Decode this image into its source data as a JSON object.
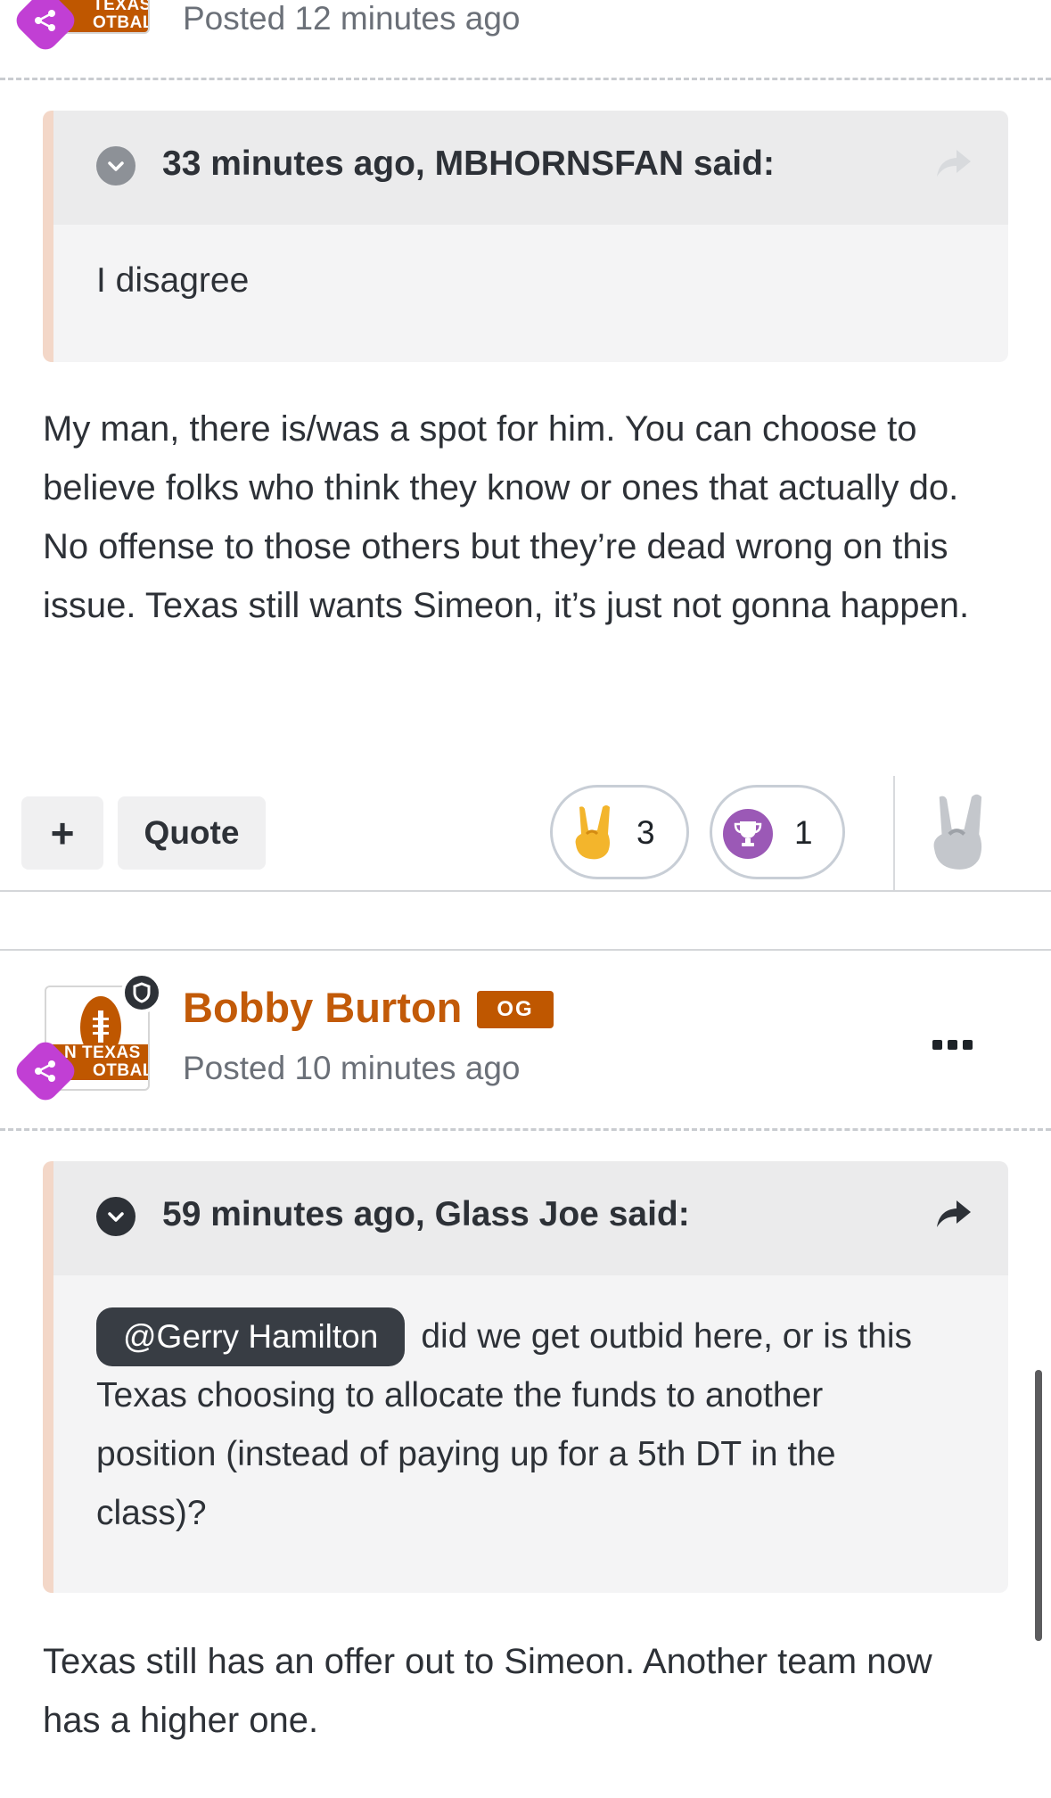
{
  "post1": {
    "posted_time": "Posted 12 minutes ago",
    "avatar_text": "TEXAS\nOTBALL",
    "quote": {
      "header": "33 minutes ago, MBHORNSFAN said:",
      "body": "I disagree"
    },
    "body": "My man, there is/was a spot for him. You can choose to believe folks who think they know or ones that actually do. No offense to those others but they’re dead wrong on this issue. Texas still wants Simeon, it’s just not gonna happen.",
    "actions": {
      "plus_label": "+",
      "quote_label": "Quote"
    },
    "reactions": [
      {
        "icon": "horns-hand-icon",
        "count": "3"
      },
      {
        "icon": "trophy-icon",
        "count": "1"
      }
    ]
  },
  "post2": {
    "author": "Bobby Burton",
    "author_badge": "OG",
    "posted_time": "Posted 10 minutes ago",
    "avatar_text_1": "N TEXAS",
    "avatar_text_2": "OTBALL",
    "quote": {
      "header": "59 minutes ago, Glass Joe said:",
      "mention": "@Gerry Hamilton",
      "body": "did we get outbid here, or is this Texas choosing to allocate the funds to another position (instead of paying up for a 5th DT in the class)?"
    },
    "body": "Texas still has an offer out to Simeon. Another team now has a higher one."
  },
  "colors": {
    "author": "#c25a08",
    "burnt_orange": "#bf5700",
    "share_badge": "#c13fd4",
    "trophy": "#9b59b6",
    "quote_border": "#f3d7c8"
  }
}
